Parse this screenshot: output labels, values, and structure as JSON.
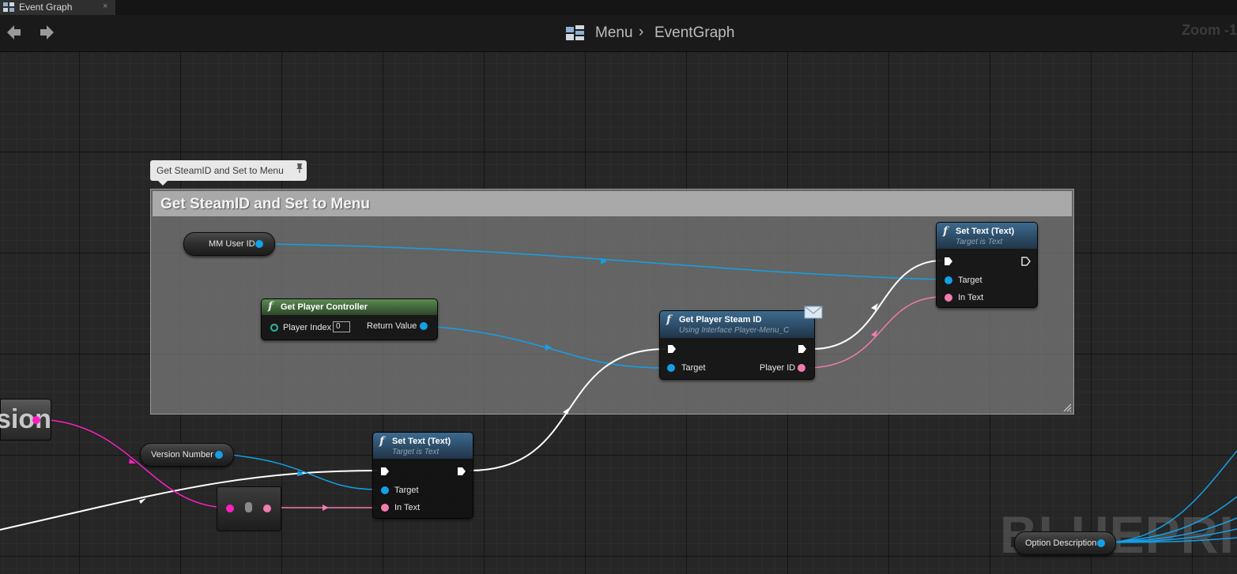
{
  "tab": {
    "label": "Event Graph",
    "close": "×"
  },
  "toolbar": {
    "breadcrumb": [
      "Menu",
      "EventGraph"
    ],
    "separator": "›",
    "zoom": "Zoom -1"
  },
  "watermark": "BLUEPRINT",
  "comment": {
    "bubble_text": "Get SteamID and Set to Menu",
    "title": "Get SteamID and Set to Menu"
  },
  "nodes": {
    "mm_user_id": {
      "label": "MM User ID"
    },
    "get_player_controller": {
      "title": "Get Player Controller",
      "player_index_label": "Player Index",
      "player_index_value": "0",
      "return_value_label": "Return Value"
    },
    "get_player_steam_id": {
      "title": "Get Player Steam ID",
      "subtitle": "Using Interface Player-Menu_C",
      "target_label": "Target",
      "player_id_label": "Player ID"
    },
    "set_text_top": {
      "title": "Set Text (Text)",
      "subtitle": "Target is Text",
      "target_label": "Target",
      "in_text_label": "In Text"
    },
    "set_text_bottom": {
      "title": "Set Text (Text)",
      "subtitle": "Target is Text",
      "target_label": "Target",
      "in_text_label": "In Text"
    },
    "version_number": {
      "label": "Version Number"
    },
    "version_partial": {
      "label": "sion"
    },
    "option_description": {
      "label": "Option Description"
    }
  },
  "colors": {
    "object_pin": "#14a0e6",
    "text_pin": "#f07caf",
    "string_pin": "#ff1fc2",
    "exec_wire": "#ffffff",
    "int_pin": "#2fb5a4"
  }
}
